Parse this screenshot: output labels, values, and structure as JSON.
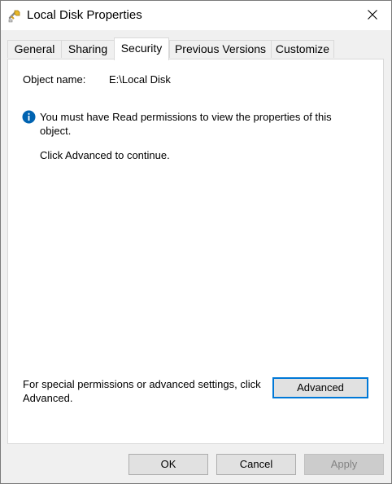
{
  "window": {
    "title": "Local Disk Properties"
  },
  "tabs": [
    {
      "label": "General"
    },
    {
      "label": "Sharing"
    },
    {
      "label": "Security",
      "active": true
    },
    {
      "label": "Previous Versions"
    },
    {
      "label": "Customize"
    }
  ],
  "security": {
    "object_label": "Object name:",
    "object_value": "E:\\Local Disk",
    "info_message": "You must have Read permissions to view the properties of this object.",
    "continue_message": "Click Advanced to continue.",
    "special_permissions_text": "For special permissions or advanced settings, click Advanced.",
    "advanced_label": "Advanced"
  },
  "buttons": {
    "ok": "OK",
    "cancel": "Cancel",
    "apply": "Apply",
    "apply_disabled": true
  },
  "colors": {
    "accent": "#0078d7",
    "info_icon": "#0063b1"
  },
  "icons": {
    "app": "drive-wrench-icon",
    "close": "close-icon",
    "info": "info-icon"
  }
}
